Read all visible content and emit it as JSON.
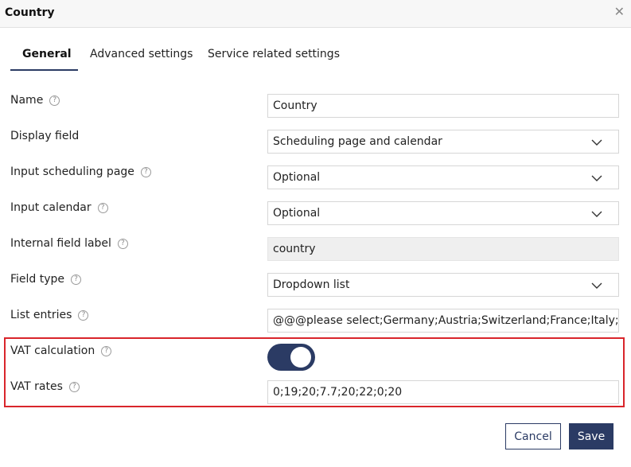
{
  "dialog": {
    "title": "Country",
    "close_icon": "close-icon"
  },
  "tabs": [
    {
      "label": "General",
      "active": true
    },
    {
      "label": "Advanced settings",
      "active": false
    },
    {
      "label": "Service related settings",
      "active": false
    }
  ],
  "fields": {
    "name": {
      "label": "Name",
      "value": "Country"
    },
    "display_field": {
      "label": "Display field",
      "value": "Scheduling page and calendar"
    },
    "input_scheduling_page": {
      "label": "Input scheduling page",
      "value": "Optional"
    },
    "input_calendar": {
      "label": "Input calendar",
      "value": "Optional"
    },
    "internal_field_label": {
      "label": "Internal field label",
      "value": "country"
    },
    "field_type": {
      "label": "Field type",
      "value": "Dropdown list"
    },
    "list_entries": {
      "label": "List entries",
      "value": "@@@please select;Germany;Austria;Switzerland;France;Italy;USA;United Kingdom"
    },
    "vat_calculation": {
      "label": "VAT calculation",
      "enabled": true
    },
    "vat_rates": {
      "label": "VAT rates",
      "value": "0;19;20;7.7;20;22;0;20"
    }
  },
  "help_glyph": "?",
  "buttons": {
    "cancel": "Cancel",
    "save": "Save"
  },
  "colors": {
    "accent": "#2b3b64",
    "highlight_border": "#d9252b",
    "readonly_bg": "#efefef"
  }
}
